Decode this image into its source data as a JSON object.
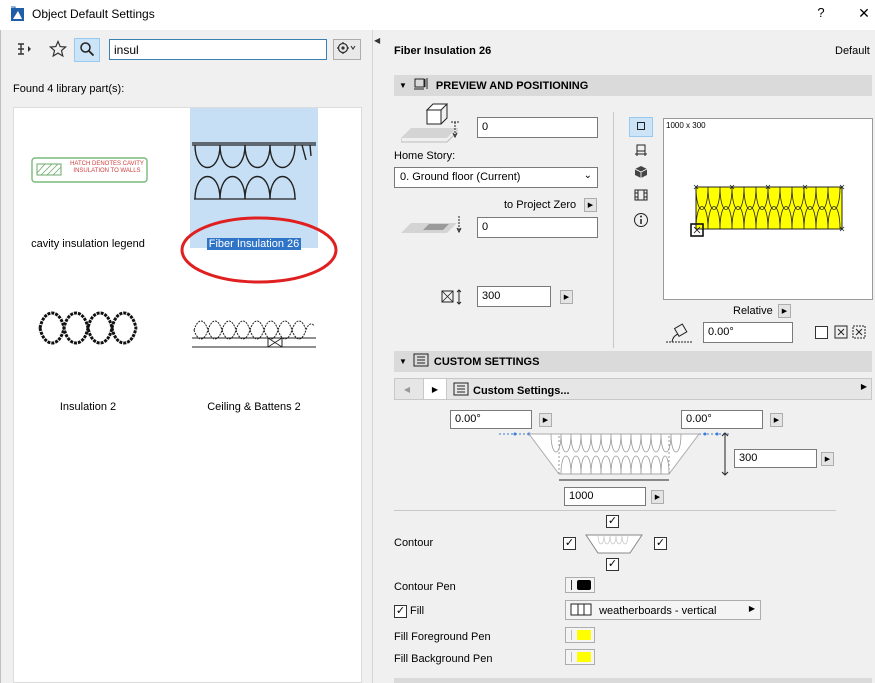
{
  "window": {
    "title": "Object Default Settings",
    "help": "?",
    "close": "✕"
  },
  "left": {
    "search_value": "insul",
    "found_text": "Found 4 library part(s):",
    "results": [
      {
        "name": "cavity insulation legend",
        "legend_text": "HATCH DENOTES CAVITY INSULATION TO WALLS"
      },
      {
        "name": "Fiber Insulation 26",
        "selected": true
      },
      {
        "name": "Insulation 2"
      },
      {
        "name": "Ceiling & Battens 2"
      }
    ]
  },
  "right": {
    "object_name": "Fiber Insulation 26",
    "default_label": "Default",
    "preview_section": {
      "title": "PREVIEW AND POSITIONING",
      "elevation_value": "0",
      "home_story_label": "Home Story:",
      "home_story_value": "0. Ground floor (Current)",
      "to_project_zero_label": "to Project Zero",
      "project_zero_value": "0",
      "height_value": "300",
      "preview_size_label": "1000 x 300",
      "relative_label": "Relative",
      "angle_value": "0.00°"
    },
    "custom_section": {
      "title": "CUSTOM SETTINGS",
      "page_title": "Custom Settings...",
      "left_angle": "0.00°",
      "right_angle": "0.00°",
      "height": "300",
      "width": "1000",
      "contour_label": "Contour",
      "contour_pen_label": "Contour Pen",
      "fill_label": "Fill",
      "fill_pattern": "weatherboards - vertical",
      "fill_fg_pen_label": "Fill Foreground Pen",
      "fill_bg_pen_label": "Fill Background Pen"
    }
  },
  "colors": {
    "insulation_fill": "#ffff00",
    "selection": "#2f74c7",
    "annotation_circle": "#e02020"
  }
}
